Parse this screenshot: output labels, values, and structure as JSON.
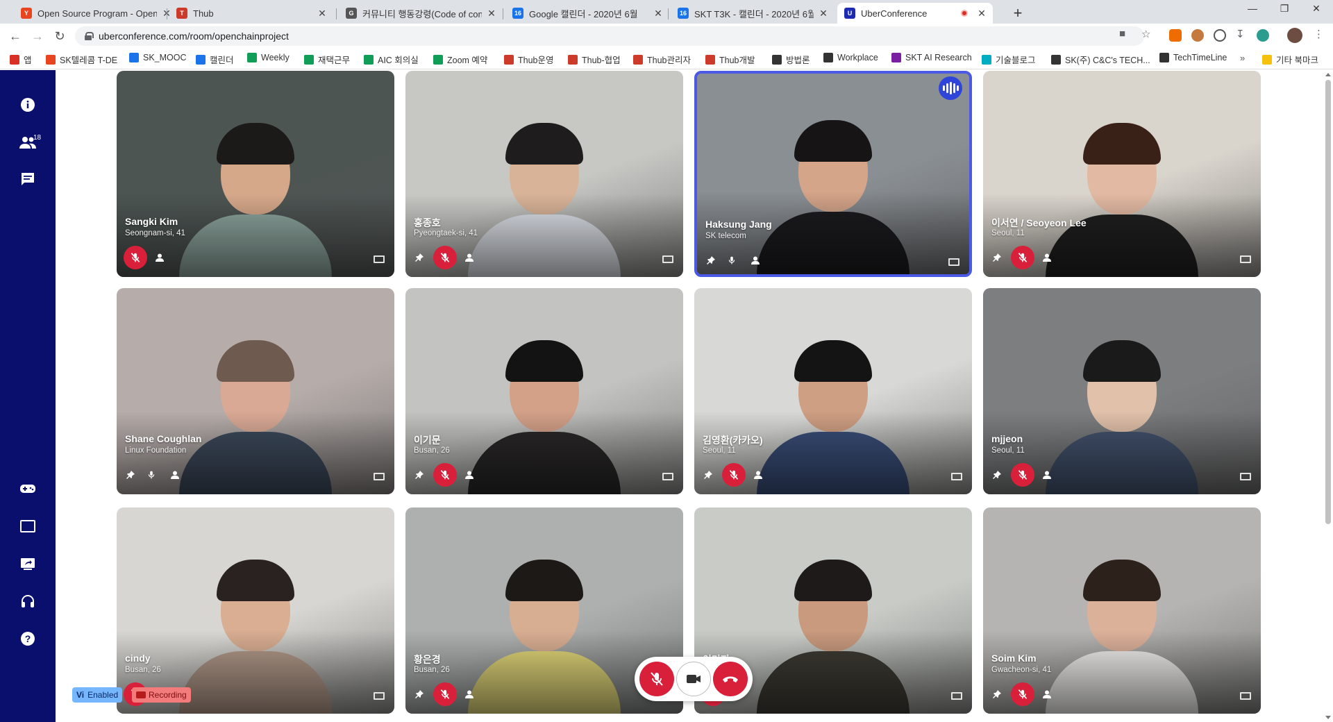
{
  "browser": {
    "tabs": [
      {
        "title": "Open Source Program - Open S",
        "fav_color": "#e8441f",
        "fav_text": "Y"
      },
      {
        "title": "Thub",
        "fav_color": "#cc3a2a",
        "fav_text": "T"
      },
      {
        "title": "커뮤니티 행동강령(Code of con",
        "fav_color": "#555555",
        "fav_text": "G"
      },
      {
        "title": "Google 캘린더 - 2020년 6월",
        "fav_color": "#1a73e8",
        "fav_text": "16"
      },
      {
        "title": "SKT T3K - 캘린더 - 2020년 6월",
        "fav_color": "#1a73e8",
        "fav_text": "16"
      },
      {
        "title": "UberConference",
        "fav_color": "#1d2bb3",
        "fav_text": "U"
      }
    ],
    "url": "uberconference.com/room/openchainproject",
    "bookmarks": [
      {
        "label": "앱",
        "color": "#d93025"
      },
      {
        "label": "SK텔레콤 T-DE",
        "color": "#e8441f"
      },
      {
        "label": "SK_MOOC",
        "color": "#1a73e8"
      },
      {
        "label": "캘린더",
        "color": "#1a73e8"
      },
      {
        "label": "Weekly",
        "color": "#0f9d58"
      },
      {
        "label": "재택근무",
        "color": "#0f9d58"
      },
      {
        "label": "AIC 회의실",
        "color": "#0f9d58"
      },
      {
        "label": "Zoom 예약",
        "color": "#0f9d58"
      },
      {
        "label": "Thub운영",
        "color": "#cc3a2a"
      },
      {
        "label": "Thub-협업",
        "color": "#cc3a2a"
      },
      {
        "label": "Thub관리자",
        "color": "#cc3a2a"
      },
      {
        "label": "Thub개발",
        "color": "#cc3a2a"
      },
      {
        "label": "방법론",
        "color": "#333333"
      },
      {
        "label": "Workplace",
        "color": "#333333"
      },
      {
        "label": "SKT AI Research",
        "color": "#7b1fa2"
      },
      {
        "label": "기술블로그",
        "color": "#00acc1"
      },
      {
        "label": "SK(주) C&C's TECH...",
        "color": "#333333"
      },
      {
        "label": "TechTimeLine",
        "color": "#333333"
      },
      {
        "label": "기타 북마크",
        "color": "#f4c20d"
      }
    ]
  },
  "sidebar": {
    "participants_count": "18",
    "icons": [
      "info-icon",
      "participants-icon",
      "chat-icon",
      "gamepad-icon",
      "screen-icon",
      "share-screen-icon",
      "headset-icon",
      "help-icon"
    ]
  },
  "participants": [
    {
      "name": "Sangki Kim",
      "location": "Seongnam-si, 41",
      "muted": true,
      "pin": false,
      "speaking": false,
      "bg": "#4d5553",
      "skin": "#d6a88a",
      "hair": "#1c1a19",
      "shirt": "#8fa7a0"
    },
    {
      "name": "홍종호",
      "location": "Pyeongtaek-si, 41",
      "muted": true,
      "pin": true,
      "speaking": false,
      "bg": "#c7c8c4",
      "skin": "#d8b398",
      "hair": "#1e1c1c",
      "shirt": "#dfe3ea"
    },
    {
      "name": "Haksung Jang",
      "location": "SK telecom",
      "muted": false,
      "pin": true,
      "speaking": true,
      "bg": "#8a8f94",
      "skin": "#d5a58a",
      "hair": "#161414",
      "shirt": "#1c1b1e"
    },
    {
      "name": "이서연 / Seoyeon Lee",
      "location": "Seoul, 11",
      "muted": true,
      "pin": true,
      "speaking": false,
      "bg": "#d9d4cc",
      "skin": "#e2b9a2",
      "hair": "#3a2118",
      "shirt": "#202020"
    },
    {
      "name": "Shane Coughlan",
      "location": "Linux Foundation",
      "muted": false,
      "pin": true,
      "speaking": false,
      "bg": "#b6adaa",
      "skin": "#d9a995",
      "hair": "#6e5a4e",
      "shirt": "#3d4a5c"
    },
    {
      "name": "이기문",
      "location": "Busan, 26",
      "muted": true,
      "pin": true,
      "speaking": false,
      "bg": "#c3c3c1",
      "skin": "#d3a088",
      "hair": "#141314",
      "shirt": "#2a2828"
    },
    {
      "name": "김영환(카카오)",
      "location": "Seoul, 11",
      "muted": true,
      "pin": true,
      "speaking": false,
      "bg": "#d8d8d6",
      "skin": "#cf9f83",
      "hair": "#151414",
      "shirt": "#3a4f7a"
    },
    {
      "name": "mjjeon",
      "location": "Seoul, 11",
      "muted": true,
      "pin": true,
      "speaking": false,
      "bg": "#7d7e80",
      "skin": "#e1c1aa",
      "hair": "#1b1a1a",
      "shirt": "#43536e"
    },
    {
      "name": "cindy",
      "location": "Busan, 26",
      "muted": true,
      "pin": false,
      "speaking": false,
      "bg": "#d7d6d2",
      "skin": "#d9ae92",
      "hair": "#2a2220",
      "shirt": "#b39a8a"
    },
    {
      "name": "황은경",
      "location": "Busan, 26",
      "muted": true,
      "pin": true,
      "speaking": false,
      "bg": "#aeb0b0",
      "skin": "#d8ae92",
      "hair": "#1c1917",
      "shirt": "#e3d87a"
    },
    {
      "name": "이미지",
      "location": "",
      "muted": true,
      "pin": false,
      "speaking": false,
      "bg": "#c8cbc6",
      "skin": "#c99a7e",
      "hair": "#1d1a19",
      "shirt": "#3d3b33"
    },
    {
      "name": "Soim Kim",
      "location": "Gwacheon-si, 41",
      "muted": true,
      "pin": true,
      "speaking": false,
      "bg": "#b5b4b2",
      "skin": "#dcb19a",
      "hair": "#2c211b",
      "shirt": "#f2f1ef"
    }
  ],
  "badges": {
    "vi_label": "Vi",
    "enabled_label": "Enabled",
    "rec_label": "Recording"
  },
  "colors": {
    "sidebar": "#0a0f6e",
    "muted_red": "#d8203a",
    "speaking_border": "#4a5ae6"
  }
}
